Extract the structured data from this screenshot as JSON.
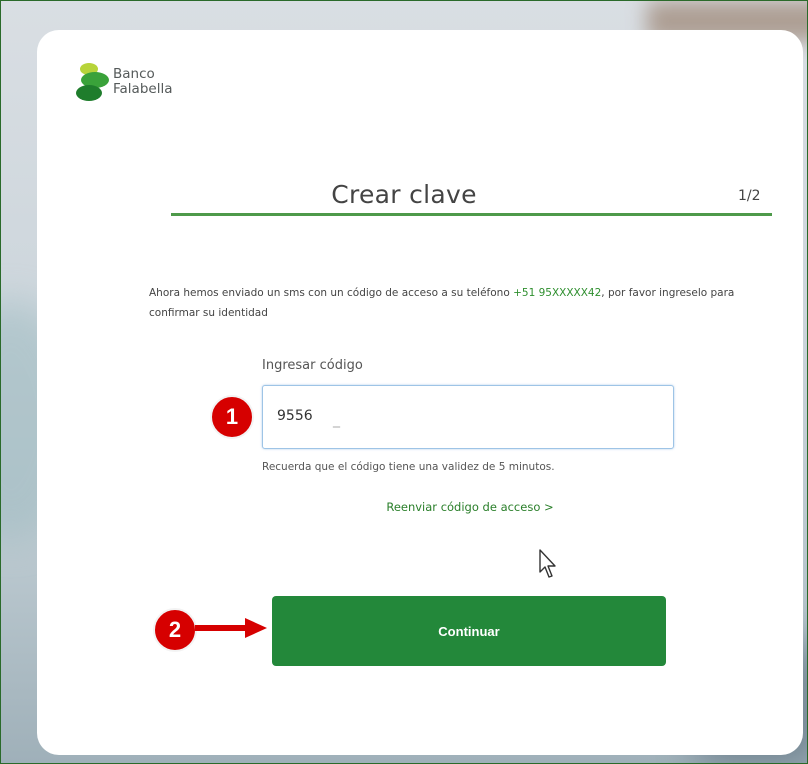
{
  "brand": {
    "line1": "Banco",
    "line2": "Falabella"
  },
  "header": {
    "title": "Crear clave",
    "step": "1/2"
  },
  "instructions": {
    "prefix": "Ahora hemos enviado un sms con un código de acceso a su teléfono ",
    "phone": "+51 95XXXXX42",
    "suffix": ", por favor ingreselo para confirmar su identidad"
  },
  "code_input": {
    "label": "Ingresar código",
    "value": "9556"
  },
  "hint": "Recuerda que el código tiene una validez de 5 minutos.",
  "resend_link": "Reenviar código de acceso >",
  "continue_button": "Continuar",
  "annotations": {
    "badge1": "1",
    "badge2": "2"
  },
  "colors": {
    "accent": "#23883a",
    "badge": "#d60000",
    "link": "#2a7f2a"
  }
}
